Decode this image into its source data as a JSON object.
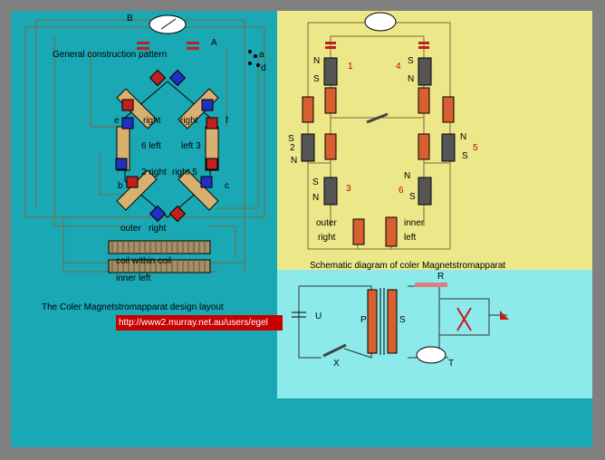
{
  "left_panel": {
    "title": "General  construction pattern",
    "caption": "The Coler Magnetstromapparat  design  layout",
    "url": "http://www2.murray.net.au/users/egel",
    "terminals": [
      "B",
      "A",
      "a",
      "d",
      "b",
      "c",
      "e",
      "f"
    ],
    "coil_labels": {
      "right_top": "right",
      "right_top2": "right",
      "left_mid": "6 left",
      "left_mid2": "left 3",
      "right_low": "2 right",
      "right_low2": "right 5",
      "outer": "outer",
      "right_bottom": "right",
      "coil_within": "coil within coil",
      "inner_left": "inner left"
    }
  },
  "schematic": {
    "title": "Schematic diagram of coler  Magnetstromapparat",
    "magnets": [
      {
        "id": "1",
        "north": "N",
        "south": "S"
      },
      {
        "id": "4",
        "north": "N",
        "south": "S"
      },
      {
        "id": "2",
        "north": "N",
        "south": "S"
      },
      {
        "id": "5",
        "north": "N",
        "south": "S"
      },
      {
        "id": "3",
        "north": "N",
        "south": "S"
      },
      {
        "id": "6",
        "north": "N",
        "south": "S"
      }
    ],
    "coil_bottom_left_1": "outer",
    "coil_bottom_left_2": "right",
    "coil_bottom_right_1": "inner",
    "coil_bottom_right_2": "left"
  },
  "circuit": {
    "U": "U",
    "P": "P",
    "S": "S",
    "X": "X",
    "T": "T",
    "R": "R"
  }
}
